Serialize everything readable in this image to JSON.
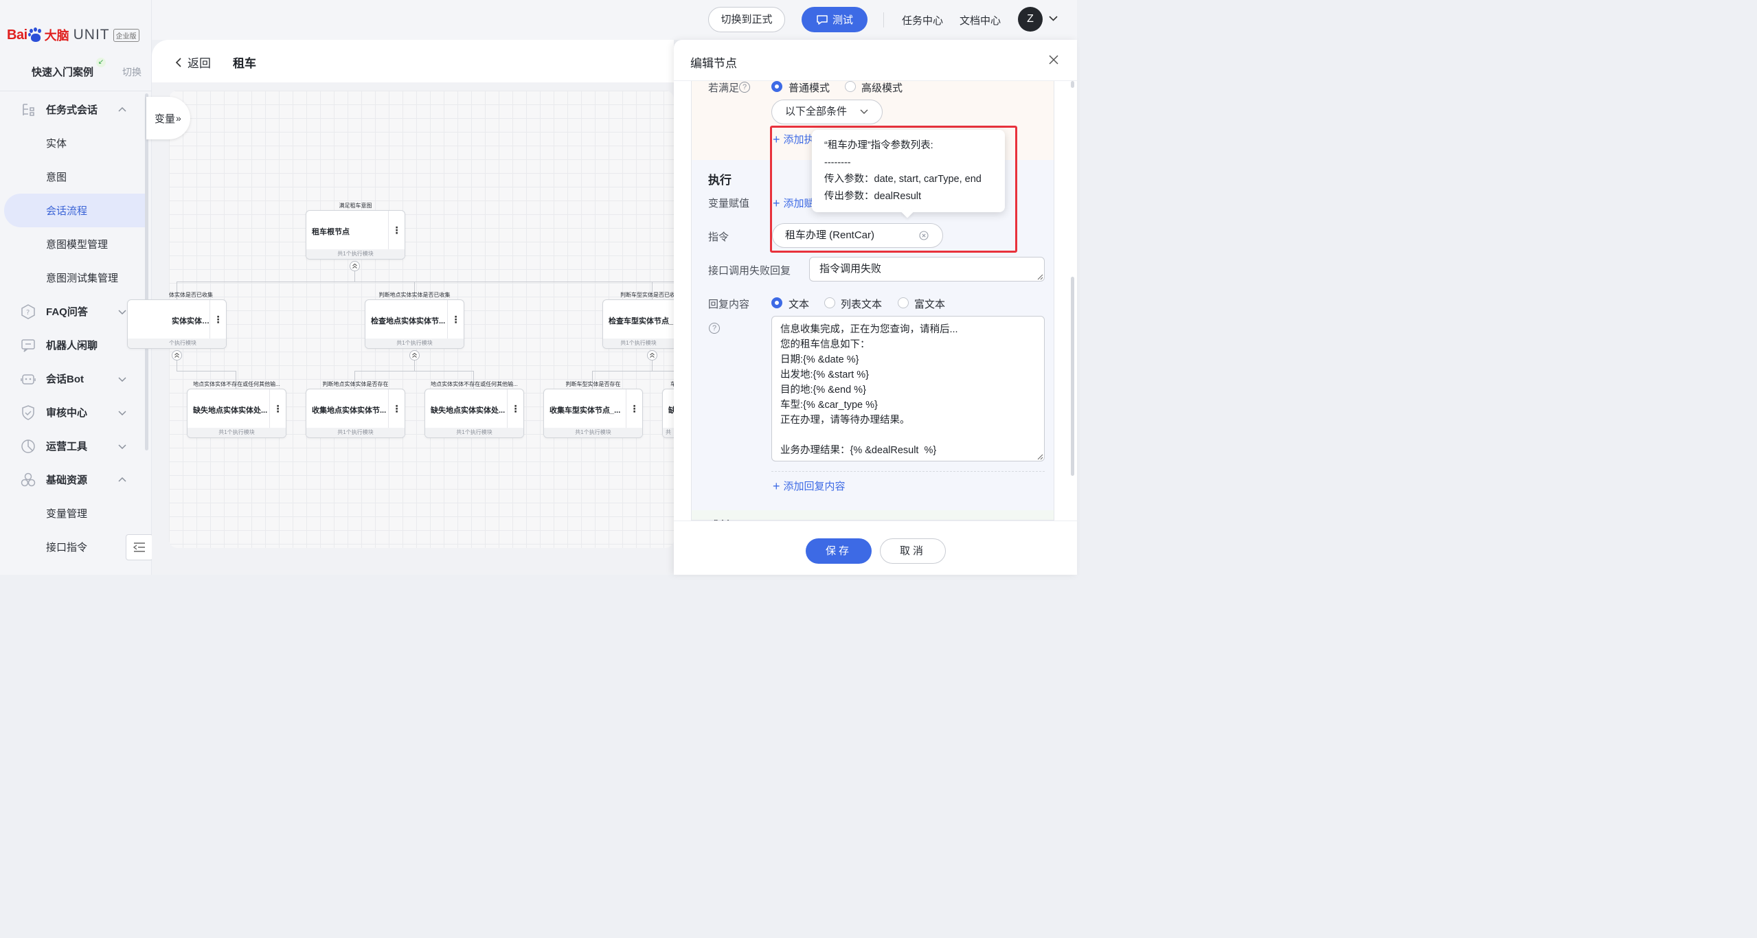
{
  "brand": {
    "baidu_prefix": "Bai",
    "baidu_suffix": "大脑",
    "product": "UNIT",
    "edition": "企业版",
    "paw_text": "du"
  },
  "project": {
    "name": "快速入门案例",
    "switch_label": "切换"
  },
  "sidebar": {
    "items": [
      {
        "label": "任务式会话",
        "level": "top",
        "icon": "task-tree-icon",
        "expanded": true
      },
      {
        "label": "实体",
        "level": "sub"
      },
      {
        "label": "意图",
        "level": "sub"
      },
      {
        "label": "会话流程",
        "level": "sub",
        "active": true
      },
      {
        "label": "意图模型管理",
        "level": "sub"
      },
      {
        "label": "意图测试集管理",
        "level": "sub"
      },
      {
        "label": "FAQ问答",
        "level": "top",
        "icon": "faq-icon",
        "expanded": false
      },
      {
        "label": "机器人闲聊",
        "level": "top",
        "icon": "chat-icon"
      },
      {
        "label": "会话Bot",
        "level": "top",
        "icon": "bot-icon",
        "expanded": false
      },
      {
        "label": "审核中心",
        "level": "top",
        "icon": "shield-icon",
        "expanded": false
      },
      {
        "label": "运营工具",
        "level": "top",
        "icon": "ops-icon",
        "expanded": false
      },
      {
        "label": "基础资源",
        "level": "top",
        "icon": "resource-icon",
        "expanded": true
      },
      {
        "label": "变量管理",
        "level": "sub"
      },
      {
        "label": "接口指令",
        "level": "sub"
      }
    ]
  },
  "header": {
    "switch_formal_label": "切换到正式",
    "test_label": "测试",
    "task_center_label": "任务中心",
    "doc_center_label": "文档中心",
    "avatar_initial": "Z"
  },
  "breadcrumb": {
    "back_label": "返回",
    "title": "租车"
  },
  "canvas": {
    "variables_tab_label": "变量",
    "root": {
      "caption": "满足租车意图",
      "name": "租车根节点",
      "footer": "共1个执行模块"
    },
    "level2": [
      {
        "caption": "体实体是否已收集",
        "name": "实体实体节...",
        "footer": "个执行模块"
      },
      {
        "caption": "判断地点实体实体是否已收集",
        "name": "检查地点实体实体节...",
        "footer": "共1个执行模块"
      },
      {
        "caption": "判断车型实体是否已收",
        "name": "检查车型实体节点_",
        "footer": "共1个执行模块"
      }
    ],
    "level3": [
      {
        "caption": "地点实体实体不存在或任何其他输...",
        "name": "缺失地点实体实体处...",
        "footer": "共1个执行模块"
      },
      {
        "caption": "判断地点实体实体是否存在",
        "name": "收集地点实体实体节...",
        "footer": "共1个执行模块"
      },
      {
        "caption": "地点实体实体不存在或任何其他输...",
        "name": "缺失地点实体实体处...",
        "footer": "共1个执行模块"
      },
      {
        "caption": "判断车型实体是否存在",
        "name": "收集车型实体节点_...",
        "footer": "共1个执行模块"
      },
      {
        "caption": "车",
        "name": "缺",
        "footer": "共"
      }
    ]
  },
  "drawer": {
    "title": "编辑节点",
    "condition": {
      "label": "若满足",
      "mode_normal": "普通模式",
      "mode_advanced": "高级模式",
      "selected_mode": "普通模式",
      "match_select": "以下全部条件",
      "add_condition_label": "添加执"
    },
    "execute": {
      "title": "执行",
      "var_assign_label": "变量赋值",
      "add_assign_label": "添加赋",
      "command_label": "指令",
      "command_value": "租车办理 (RentCar)",
      "fail_reply_label": "接口调用失败回复",
      "fail_reply_value": "指令调用失败",
      "reply_label": "回复内容",
      "reply_types": [
        "文本",
        "列表文本",
        "富文本"
      ],
      "reply_selected": "文本",
      "reply_lines": [
        "信息收集完成，正在为您查询，请稍后...",
        "您的租车信息如下：",
        "日期:{% &date %}",
        "出发地:{% &start %}",
        "目的地:{% &end %}",
        "车型:{% &car_type %}",
        "正在办理，请等待办理结果。",
        "",
        "业务办理结果：{% &dealResult  %}"
      ],
      "add_reply_label": "添加回复内容"
    },
    "jump_title": "跳转",
    "tooltip": {
      "line1": "“租车办理”指令参数列表:",
      "line2": "--------",
      "line3": "传入参数：date, start, carType, end",
      "line4": "传出参数：dealResult"
    },
    "save_label": "保存",
    "cancel_label": "取消"
  },
  "colors": {
    "accent": "#3d6ae5",
    "brand_red": "#e0201f",
    "highlight": "#e8323c"
  }
}
